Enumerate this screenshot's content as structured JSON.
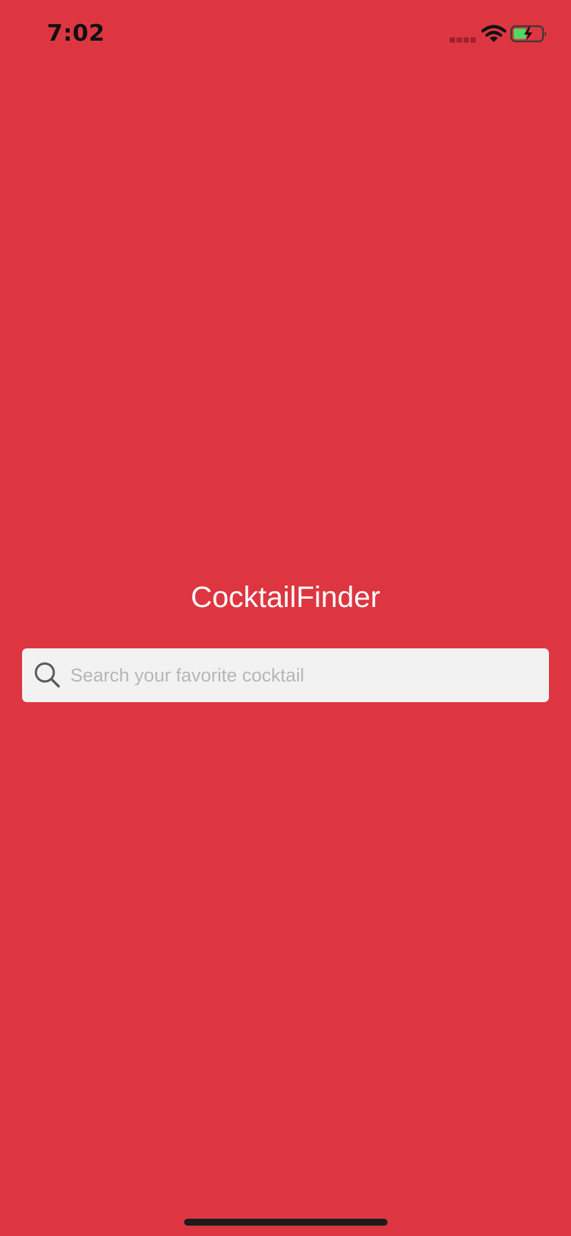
{
  "status_bar": {
    "time": "7:02",
    "icons": [
      "signal-icon",
      "wifi-icon",
      "battery-charging-icon"
    ]
  },
  "main": {
    "title": "CocktailFinder",
    "search": {
      "value": "",
      "placeholder": "Search your favorite cocktail",
      "icon": "search-icon"
    }
  },
  "colors": {
    "background": "#de3641",
    "title_text": "#ffffff",
    "search_background": "#f2f2f2",
    "placeholder_text": "#b6b6b6",
    "battery_fill": "#4cd964"
  }
}
